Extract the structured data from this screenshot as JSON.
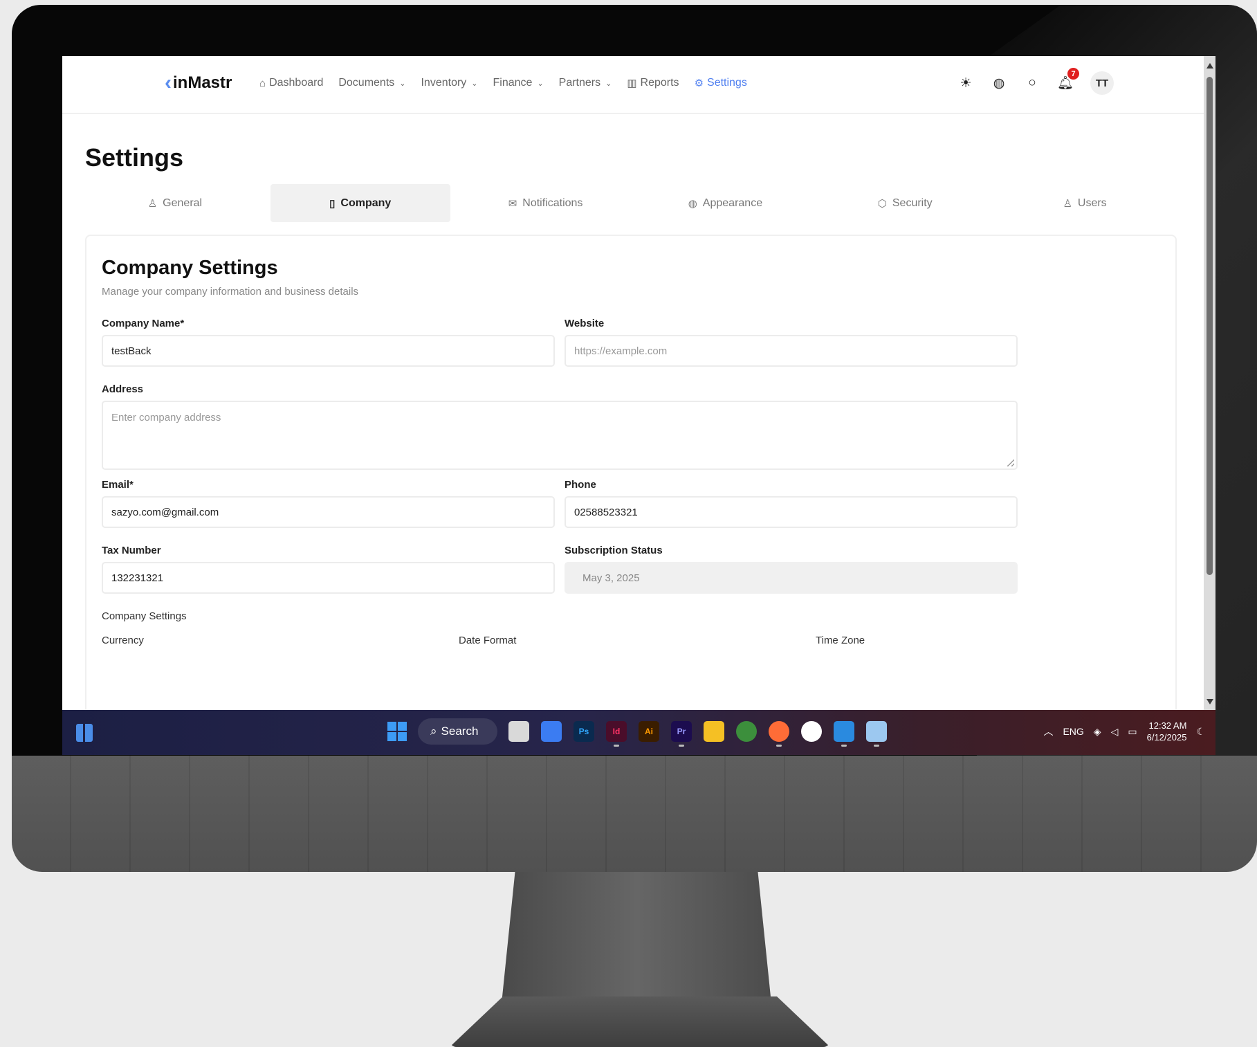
{
  "nav": {
    "logo": "inMastr",
    "items": [
      {
        "label": "Dashboard",
        "icon": "home-icon"
      },
      {
        "label": "Documents",
        "icon": ""
      },
      {
        "label": "Inventory",
        "icon": ""
      },
      {
        "label": "Finance",
        "icon": ""
      },
      {
        "label": "Partners",
        "icon": ""
      },
      {
        "label": "Reports",
        "icon": "chart-icon"
      },
      {
        "label": "Settings",
        "icon": "gear-icon"
      }
    ],
    "notification_count": "7",
    "avatar_initials": "TT"
  },
  "page": {
    "title": "Settings",
    "tabs": [
      {
        "label": "General"
      },
      {
        "label": "Company"
      },
      {
        "label": "Notifications"
      },
      {
        "label": "Appearance"
      },
      {
        "label": "Security"
      },
      {
        "label": "Users"
      }
    ],
    "active_tab": "Company"
  },
  "card": {
    "title": "Company Settings",
    "subtitle": "Manage your company information and business details",
    "company_name_label": "Company Name*",
    "company_name_value": "testBack",
    "website_label": "Website",
    "website_placeholder": "https://example.com",
    "address_label": "Address",
    "address_placeholder": "Enter company address",
    "email_label": "Email*",
    "email_value": "sazyo.com@gmail.com",
    "phone_label": "Phone",
    "phone_value": "02588523321",
    "tax_label": "Tax Number",
    "tax_value": "132231321",
    "subscription_label": "Subscription Status",
    "subscription_value": "May 3, 2025",
    "section_label": "Company Settings",
    "currency_label": "Currency",
    "date_format_label": "Date Format",
    "time_zone_label": "Time Zone"
  },
  "taskbar": {
    "search_label": "Search",
    "apps": [
      {
        "name": "file-explorer-gray",
        "label": "",
        "color": "#d9d9d9"
      },
      {
        "name": "jetbrains",
        "label": "",
        "color": "#3b7cf2"
      },
      {
        "name": "photoshop",
        "label": "Ps",
        "color": "#0a2a4f"
      },
      {
        "name": "indesign",
        "label": "Id",
        "color": "#4a0d2a"
      },
      {
        "name": "illustrator",
        "label": "Ai",
        "color": "#3a1d00"
      },
      {
        "name": "premiere",
        "label": "Pr",
        "color": "#1c0c4f"
      },
      {
        "name": "folder",
        "label": "",
        "color": "#f5c024"
      },
      {
        "name": "chrome",
        "label": "",
        "color": "#3c8f3c"
      },
      {
        "name": "postman",
        "label": "",
        "color": "#ff6c37"
      },
      {
        "name": "atlas",
        "label": "",
        "color": "#ffffff"
      },
      {
        "name": "vscode",
        "label": "",
        "color": "#2a8adf"
      },
      {
        "name": "viewer",
        "label": "",
        "color": "#9cc8f0"
      }
    ],
    "lang": "ENG",
    "time": "12:32 AM",
    "date": "6/12/2025"
  }
}
